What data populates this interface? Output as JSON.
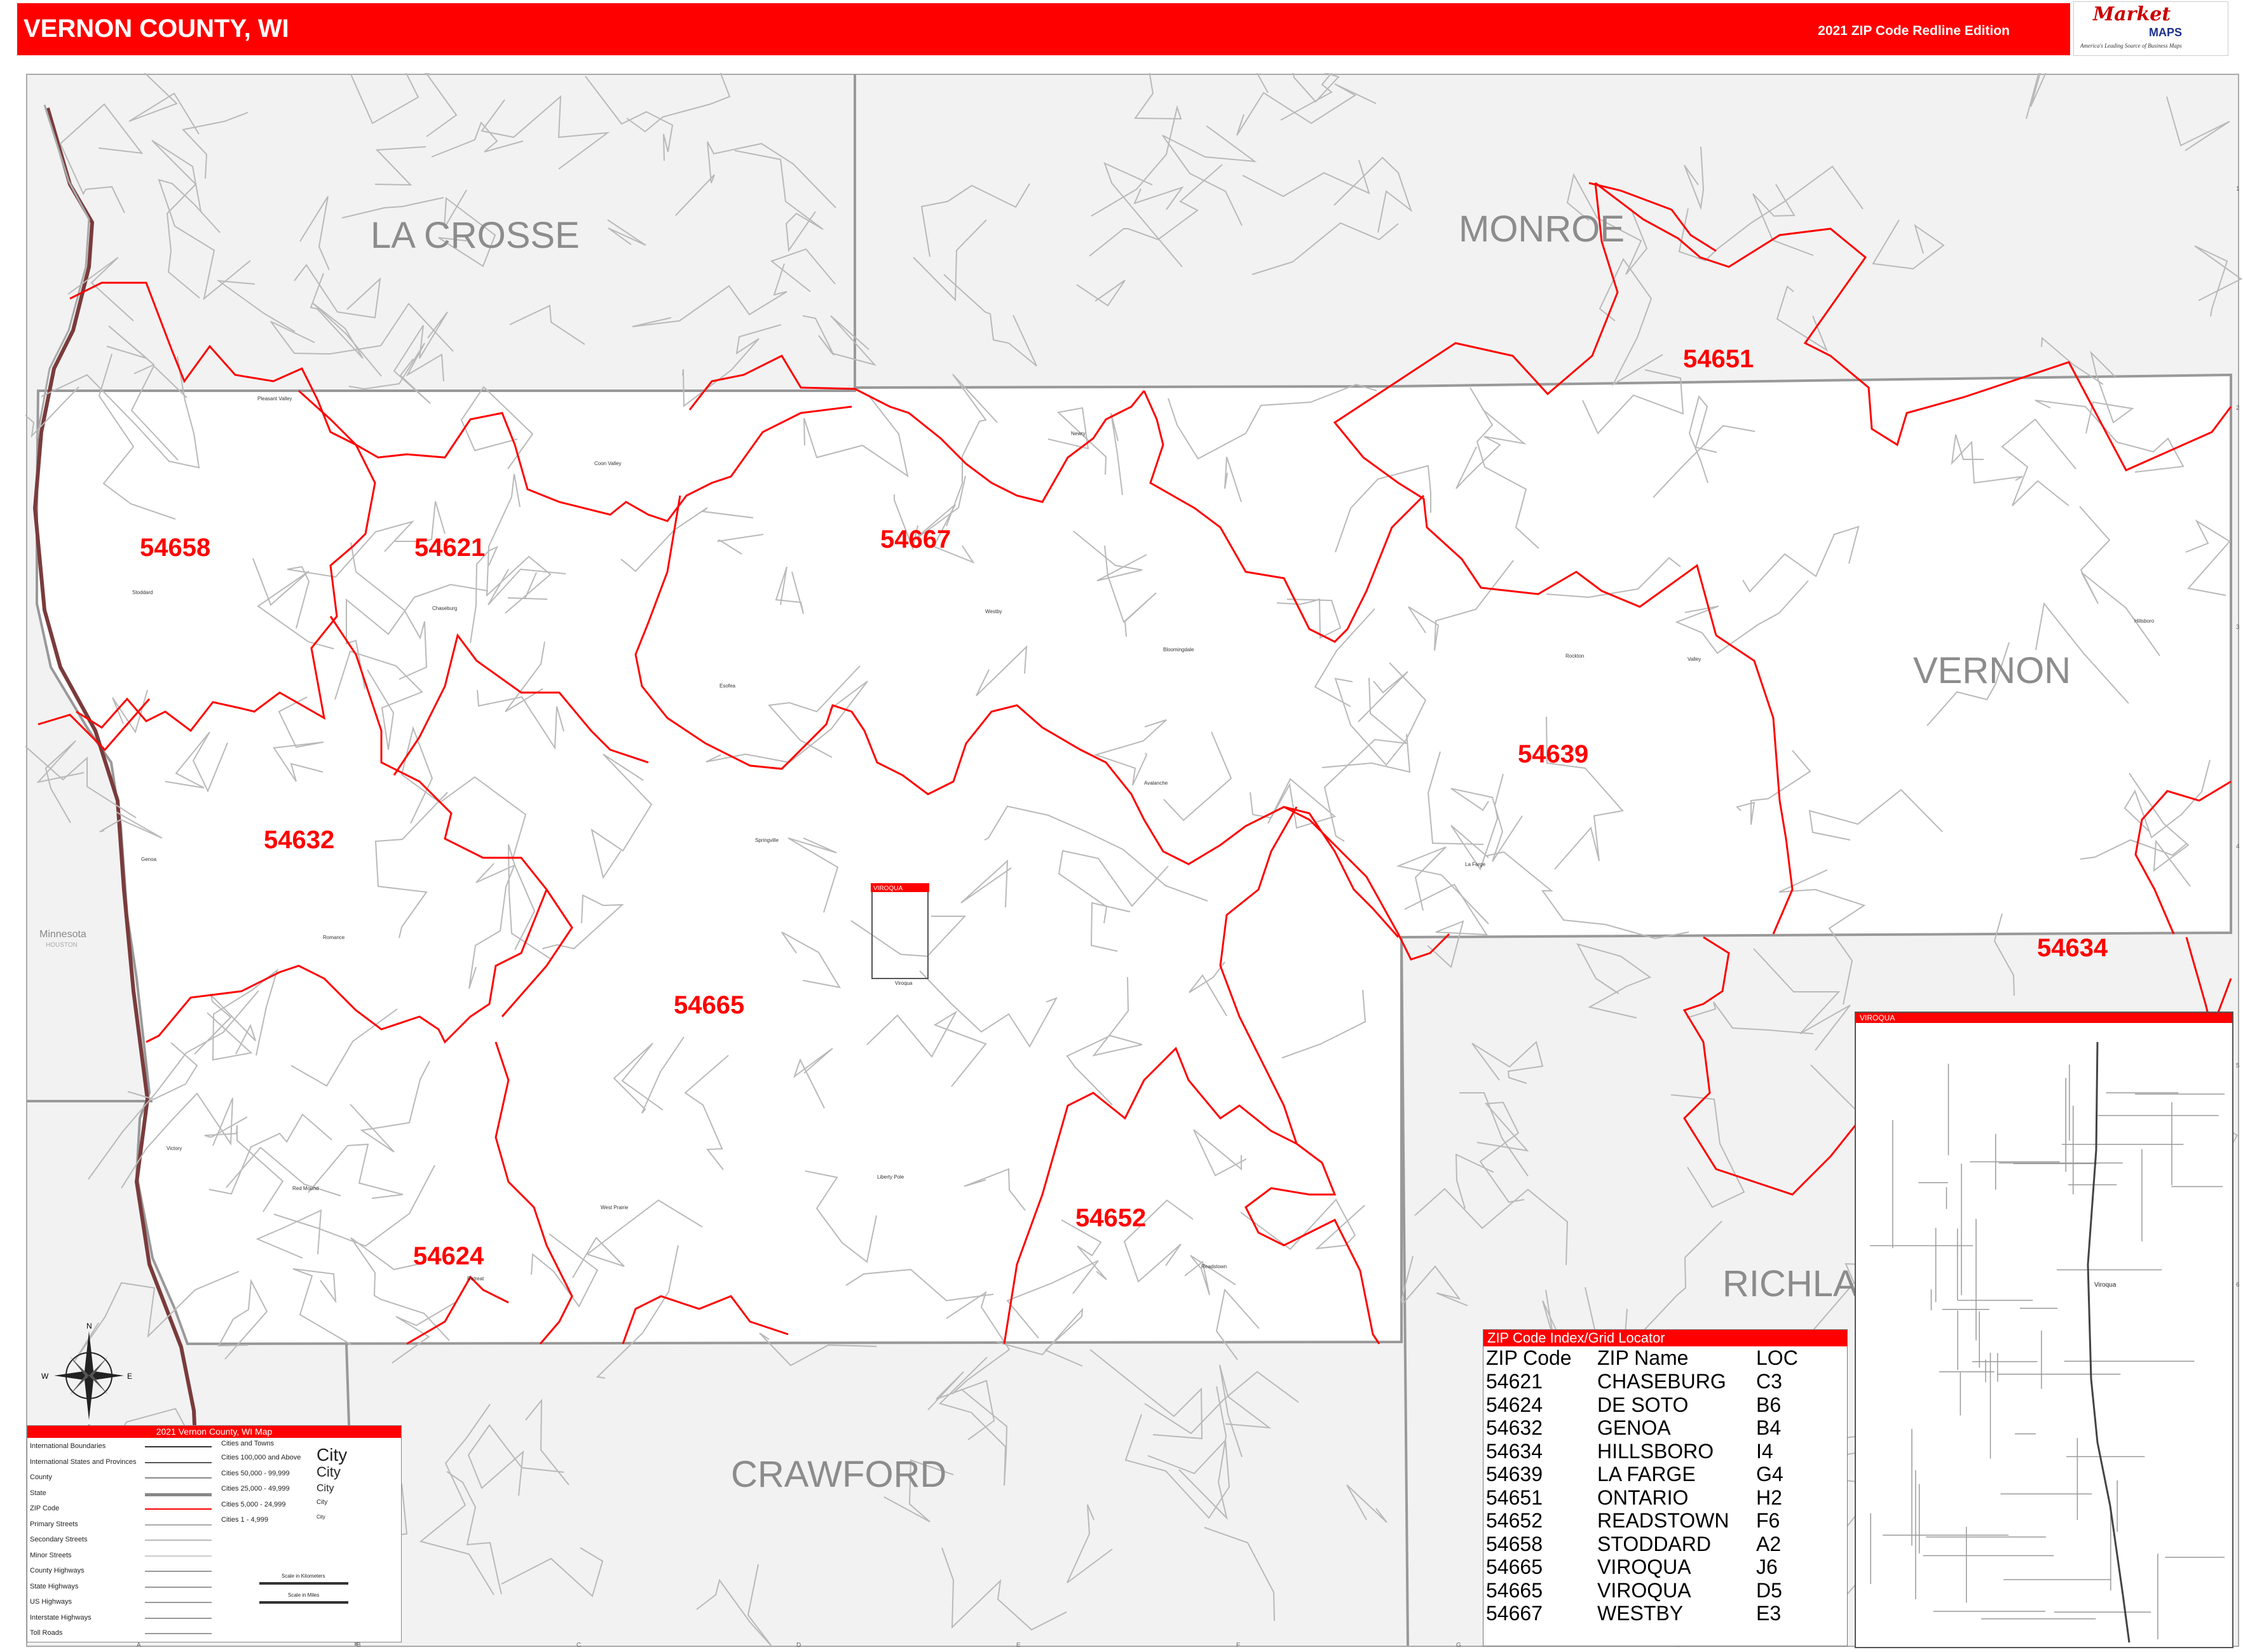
{
  "header": {
    "title": "VERNON COUNTY, WI",
    "edition": "2021 ZIP Code Redline Edition"
  },
  "logo": {
    "brand_top": "Market",
    "brand_bottom": "MAPS",
    "tagline": "America's Leading Source of Business Maps"
  },
  "grid": {
    "columns": [
      "A",
      "B",
      "C",
      "D",
      "E",
      "F",
      "G",
      "H",
      "I",
      "J"
    ],
    "rows": [
      "1",
      "2",
      "3",
      "4",
      "5",
      "6"
    ]
  },
  "counties": [
    {
      "name": "LA CROSSE"
    },
    {
      "name": "MONROE"
    },
    {
      "name": "VERNON"
    },
    {
      "name": "CRAWFORD"
    },
    {
      "name": "RICHLA"
    }
  ],
  "state_label": {
    "name": "Minnesota",
    "sub": "HOUSTON"
  },
  "zip_labels": [
    {
      "zip": "54651"
    },
    {
      "zip": "54658"
    },
    {
      "zip": "54621"
    },
    {
      "zip": "54667"
    },
    {
      "zip": "54639"
    },
    {
      "zip": "54632"
    },
    {
      "zip": "54665"
    },
    {
      "zip": "54634"
    },
    {
      "zip": "54652"
    },
    {
      "zip": "54624"
    }
  ],
  "places": [
    {
      "name": "Pleasant Valley"
    },
    {
      "name": "Stoddard"
    },
    {
      "name": "Chaseburg"
    },
    {
      "name": "Coon Valley"
    },
    {
      "name": "Newry"
    },
    {
      "name": "Westby"
    },
    {
      "name": "Esofea"
    },
    {
      "name": "Bloomingdale"
    },
    {
      "name": "Rockton"
    },
    {
      "name": "Valley"
    },
    {
      "name": "Hillsboro"
    },
    {
      "name": "Avalanche"
    },
    {
      "name": "Genoa"
    },
    {
      "name": "Springville"
    },
    {
      "name": "La Farge"
    },
    {
      "name": "Romance"
    },
    {
      "name": "Viroqua"
    },
    {
      "name": "Victory"
    },
    {
      "name": "Liberty Pole"
    },
    {
      "name": "Red Mound"
    },
    {
      "name": "West Prairie"
    },
    {
      "name": "Readstown"
    },
    {
      "name": "Retreat"
    }
  ],
  "viroqua_box_label": "VIROQUA",
  "compass": {
    "n": "N",
    "s": "S",
    "e": "E",
    "w": "W"
  },
  "legend": {
    "title": "2021 Vernon County, WI Map",
    "lines": [
      "International Boundaries",
      "International States and Provinces",
      "County",
      "State",
      "ZIP Code",
      "Primary Streets",
      "Secondary Streets",
      "Minor Streets",
      "County Highways",
      "State Highways",
      "US Highways",
      "Interstate Highways",
      "Toll Roads"
    ],
    "cities_title": "Cities and Towns",
    "cities": [
      {
        "label": "Cities 100,000 and Above",
        "sample": "City"
      },
      {
        "label": "Cities 50,000 - 99,999",
        "sample": "City"
      },
      {
        "label": "Cities 25,000 - 49,999",
        "sample": "City"
      },
      {
        "label": "Cities 5,000 - 24,999",
        "sample": "City"
      },
      {
        "label": "Cities 1 - 4,999",
        "sample": "City"
      }
    ],
    "scale_km": "Scale in Kilometers",
    "scale_mi": "Scale in Miles"
  },
  "zip_index": {
    "title": "ZIP Code Index/Grid Locator",
    "headers": [
      "ZIP Code",
      "ZIP Name",
      "LOC"
    ],
    "rows": [
      [
        "54621",
        "CHASEBURG",
        "C3"
      ],
      [
        "54624",
        "DE SOTO",
        "B6"
      ],
      [
        "54632",
        "GENOA",
        "B4"
      ],
      [
        "54634",
        "HILLSBORO",
        "I4"
      ],
      [
        "54639",
        "LA FARGE",
        "G4"
      ],
      [
        "54651",
        "ONTARIO",
        "H2"
      ],
      [
        "54652",
        "READSTOWN",
        "F6"
      ],
      [
        "54658",
        "STODDARD",
        "A2"
      ],
      [
        "54665",
        "VIROQUA",
        "J6"
      ],
      [
        "54665",
        "VIROQUA",
        "D5"
      ],
      [
        "54667",
        "WESTBY",
        "E3"
      ]
    ]
  },
  "inset": {
    "title": "VIROQUA"
  },
  "colors": {
    "accent": "#ff0000",
    "county_fill": "#f2f2f2",
    "county_line": "#999999",
    "state_line": "#7a3b3b"
  }
}
